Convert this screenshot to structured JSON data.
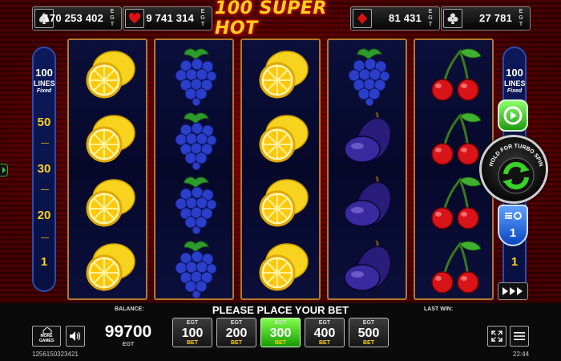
{
  "jackpots": [
    {
      "suit": "spade-icon",
      "amount": "170 253 402",
      "currency": "EGT"
    },
    {
      "suit": "heart-icon",
      "amount": "9 741 314",
      "currency": "EGT"
    },
    {
      "suit": "diamond-icon",
      "amount": "81 431",
      "currency": "EGT"
    },
    {
      "suit": "club-icon",
      "amount": "27 781",
      "currency": "EGT"
    }
  ],
  "game_title": "100 SUPER HOT",
  "lines_panel": {
    "count": "100",
    "label": "LINES",
    "mode": "Fixed",
    "markers": [
      "50",
      "30",
      "20",
      "1"
    ]
  },
  "right_lines_panel": {
    "count": "100",
    "label": "LINES",
    "mode": "Fixed",
    "markers": [
      "1"
    ]
  },
  "reels": [
    [
      "lemon",
      "lemon",
      "lemon",
      "lemon"
    ],
    [
      "grapes",
      "grapes",
      "grapes",
      "grapes"
    ],
    [
      "lemon",
      "lemon",
      "lemon",
      "lemon"
    ],
    [
      "grapes",
      "plum",
      "plum",
      "plum"
    ],
    [
      "cherry",
      "cherry",
      "cherry",
      "cherry"
    ]
  ],
  "controls": {
    "spin_hint": "HOLD FOR TURBO SPIN",
    "bet_multiplier": "1"
  },
  "bottom": {
    "balance_label": "BALANCE:",
    "balance": "99700",
    "balance_currency": "EGT",
    "message": "PLEASE PLACE YOUR BET",
    "last_win_label": "LAST WIN:",
    "more_games": "MORE GAMES",
    "bets": [
      {
        "currency": "EGT",
        "value": "100",
        "suffix": "BET",
        "active": false
      },
      {
        "currency": "EGT",
        "value": "200",
        "suffix": "BET",
        "active": false
      },
      {
        "currency": "EGT",
        "value": "300",
        "suffix": "BET",
        "active": true
      },
      {
        "currency": "EGT",
        "value": "400",
        "suffix": "BET",
        "active": false
      },
      {
        "currency": "EGT",
        "value": "500",
        "suffix": "BET",
        "active": false
      }
    ],
    "session_id": "1256150323421",
    "clock": "22:44"
  },
  "colors": {
    "gold": "#ffd21a",
    "active_green": "#169a05",
    "reel_border": "#b07a2a",
    "lines_blue": "#2b4bb0"
  }
}
